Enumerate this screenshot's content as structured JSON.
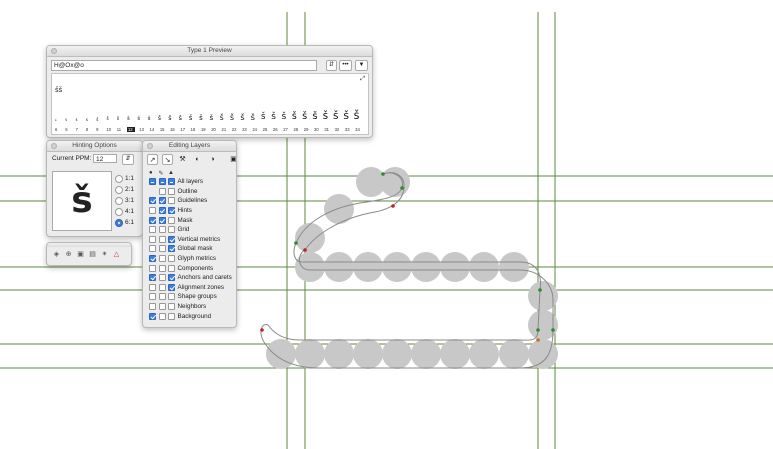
{
  "colors": {
    "guide": "#5b8a3c",
    "hint_fill": "#c8c8c8",
    "outline": "#8a8a8a",
    "check": "#3b7fe0"
  },
  "preview": {
    "title": "Type 1 Preview",
    "text_value": "H@Ox@o",
    "stepper_icon": "updown-stepper-icon",
    "more_label": "•••",
    "menu_icon": "triangle-down-icon",
    "big_sample": "šš",
    "sizes_text": "šššššššššššššššššššššššššššššššššš",
    "size_labels": [
      "6",
      "6",
      "7",
      "8",
      "9",
      "10",
      "11",
      "12",
      "13",
      "14",
      "15",
      "16",
      "17",
      "18",
      "19",
      "20",
      "21",
      "22",
      "23",
      "24",
      "25",
      "26",
      "27",
      "28",
      "29",
      "30",
      "31",
      "32",
      "33",
      "34"
    ],
    "selected_size": "12",
    "corner_icon": "resize-icon"
  },
  "hinting": {
    "title": "Hinting Options",
    "ppm_label": "Current PPM:",
    "ppm_value": "12",
    "glyph": "š",
    "ratios": [
      {
        "label": "1:1",
        "selected": false
      },
      {
        "label": "2:1",
        "selected": false
      },
      {
        "label": "3:1",
        "selected": false
      },
      {
        "label": "4:1",
        "selected": false
      },
      {
        "label": "6:1",
        "selected": true
      }
    ]
  },
  "toolbar": {
    "icons": [
      "shield-icon",
      "globe-icon",
      "camera-icon",
      "image-icon",
      "star-icon",
      "outline-icon"
    ],
    "glyphs": [
      "◈",
      "⊕",
      "▣",
      "▤",
      "✶",
      "△"
    ]
  },
  "layers": {
    "title": "Editing Layers",
    "tool_glyphs": [
      "↗",
      "↘",
      "⚒",
      "◐",
      "◑",
      "▣"
    ],
    "head_glyphs": [
      "●",
      "✎",
      "▲"
    ],
    "items": [
      {
        "label": "All layers",
        "a": "mid",
        "b": "mid",
        "c": "mid"
      },
      {
        "label": "Outline",
        "a": "blank",
        "b": "off",
        "c": "off"
      },
      {
        "label": "Guidelines",
        "a": "on",
        "b": "on",
        "c": "off"
      },
      {
        "label": "Hints",
        "a": "off",
        "b": "on",
        "c": "on"
      },
      {
        "label": "Mask",
        "a": "on",
        "b": "on",
        "c": "off"
      },
      {
        "label": "Grid",
        "a": "off",
        "b": "off",
        "c": "off"
      },
      {
        "label": "Vertical metrics",
        "a": "off",
        "b": "off",
        "c": "on"
      },
      {
        "label": "Global mask",
        "a": "off",
        "b": "off",
        "c": "on"
      },
      {
        "label": "Glyph metrics",
        "a": "on",
        "b": "off",
        "c": "off"
      },
      {
        "label": "Components",
        "a": "off",
        "b": "off",
        "c": "off"
      },
      {
        "label": "Anchors and carets",
        "a": "on",
        "b": "off",
        "c": "on"
      },
      {
        "label": "Alignment zones",
        "a": "off",
        "b": "off",
        "c": "on"
      },
      {
        "label": "Shape groups",
        "a": "off",
        "b": "off",
        "c": "off"
      },
      {
        "label": "Neighbors",
        "a": "off",
        "b": "off",
        "c": "off"
      },
      {
        "label": "Background",
        "a": "on",
        "b": "off",
        "c": "off"
      }
    ]
  }
}
